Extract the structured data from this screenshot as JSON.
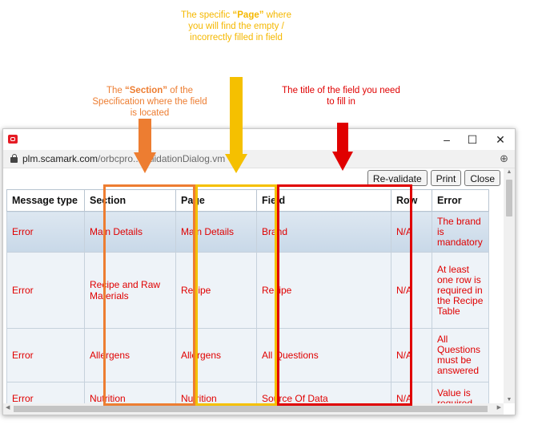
{
  "annotations": {
    "page": {
      "pre": "The specific ",
      "bold": "“Page”",
      "post": " where you will find the empty / incorrectly filled in field"
    },
    "section": {
      "pre": "The ",
      "bold": "“Section”",
      "post": " of the Specification where the field is located"
    },
    "field": {
      "text": "The title of the field you need to fill in"
    }
  },
  "colors": {
    "section": "#ed7d31",
    "page": "#f5c000",
    "field": "#e00000",
    "error_text": "#e00000"
  },
  "window": {
    "controls": {
      "minimize": "–",
      "maximize": "☐",
      "close": "✕"
    },
    "url_host": "plm.scamark.com",
    "url_path": "/orbcpro...ValidationDialog.vm",
    "zoom_icon": "⊕"
  },
  "toolbar": {
    "revalidate": "Re-validate",
    "print": "Print",
    "close": "Close"
  },
  "table": {
    "headers": [
      "Message type",
      "Section",
      "Page",
      "Field",
      "Row",
      "Error"
    ],
    "rows": [
      {
        "type": "Error",
        "section": "Main Details",
        "page": "Main Details",
        "field": "Brand",
        "row": "N/A",
        "error": "The brand is mandatory"
      },
      {
        "type": "Error",
        "section": "Recipe and Raw Materials",
        "page": "Recipe",
        "field": "Recipe",
        "row": "N/A",
        "error": "At least one row is required in the Recipe Table"
      },
      {
        "type": "Error",
        "section": "Allergens",
        "page": "Allergens",
        "field": "All Questions",
        "row": "N/A",
        "error": "All Questions must be answered"
      },
      {
        "type": "Error",
        "section": "Nutrition",
        "page": "Nutrition",
        "field": "Source Of Data",
        "row": "N/A",
        "error": "Value is required"
      }
    ]
  }
}
